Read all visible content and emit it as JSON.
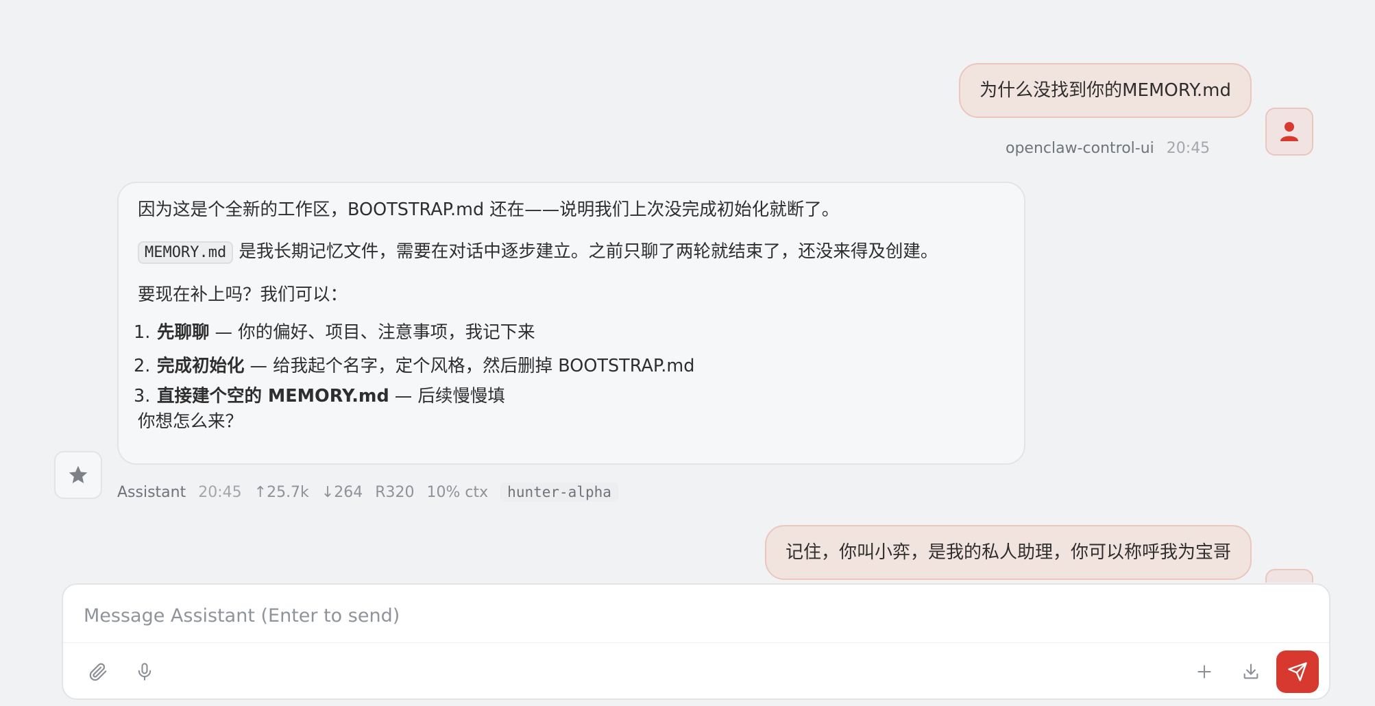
{
  "messages": [
    {
      "role": "user",
      "text": "为什么没找到你的MEMORY.md",
      "sender": "openclaw-control-ui",
      "time": "20:45"
    },
    {
      "role": "assistant",
      "paragraph1": "因为这是个全新的工作区，BOOTSTRAP.md 还在——说明我们上次没完成初始化就断了。",
      "paragraph2_code": "MEMORY.md",
      "paragraph2_rest": " 是我长期记忆文件，需要在对话中逐步建立。之前只聊了两轮就结束了，还没来得及创建。",
      "paragraph3": "要现在补上吗？我们可以：",
      "options": [
        {
          "num": "1.",
          "bold": "先聊聊",
          "rest": "— 你的偏好、项目、注意事项，我记下来"
        },
        {
          "num": "2.",
          "bold": "完成初始化",
          "rest": "— 给我起个名字，定个风格，然后删掉 BOOTSTRAP.md"
        },
        {
          "num": "3.",
          "bold": "直接建个空的 MEMORY.md",
          "rest": "— 后续慢慢填"
        }
      ],
      "closing": "你想怎么来？",
      "sender": "Assistant",
      "time": "20:45",
      "tokens_in": "↑25.7k",
      "tokens_out": "↓264",
      "reasoning": "R320",
      "ctx": "10% ctx",
      "model": "hunter-alpha"
    },
    {
      "role": "user",
      "text": "记住，你叫小弈，是我的私人助理，你可以称呼我为宝哥"
    }
  ],
  "composer": {
    "placeholder": "Message Assistant (Enter to send)"
  },
  "colors": {
    "accent": "#d8392f",
    "user_bubble_bg": "#f1e4df",
    "user_bubble_border": "#ecc6bc",
    "background": "#f1f2f4"
  },
  "icons": {
    "user_avatar": "person-icon",
    "assistant_avatar": "star-icon",
    "attach": "paperclip-icon",
    "mic": "microphone-icon",
    "add": "plus-icon",
    "download": "download-icon",
    "send": "send-icon"
  }
}
